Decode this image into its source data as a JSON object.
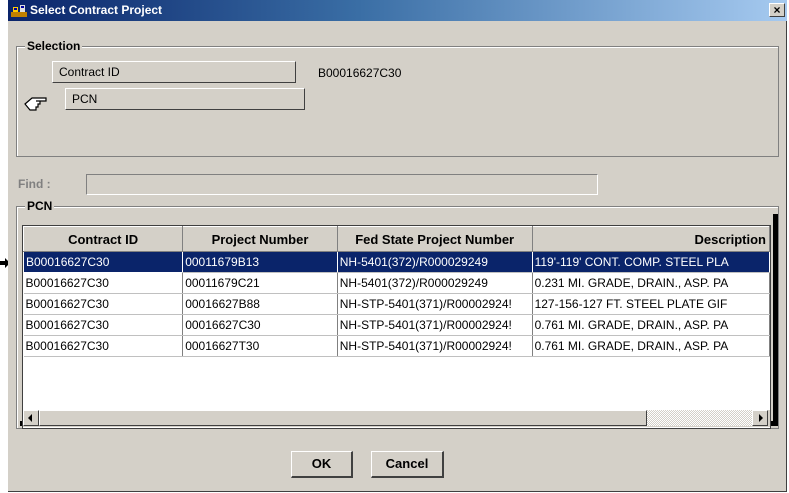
{
  "window": {
    "title": "Select Contract Project",
    "close_label": "×"
  },
  "selection": {
    "group_label": "Selection",
    "contract_id_label": "Contract ID",
    "contract_id_value": "B00016627C30",
    "pcn_label": "PCN",
    "pointer_icon": "pointing-hand-icon"
  },
  "find": {
    "label": "Find :",
    "value": ""
  },
  "pcn": {
    "group_label": "PCN",
    "columns": [
      "Contract ID",
      "Project Number",
      "Fed State Project Number",
      "Description"
    ],
    "rows": [
      [
        "B00016627C30",
        "00011679B13",
        "NH-5401(372)/R000029249",
        "119'-119' CONT. COMP. STEEL PLA"
      ],
      [
        "B00016627C30",
        "00011679C21",
        "NH-5401(372)/R000029249",
        "0.231 MI. GRADE, DRAIN., ASP. PA"
      ],
      [
        "B00016627C30",
        "00016627B88",
        "NH-STP-5401(371)/R00002924!",
        "127-156-127 FT. STEEL PLATE GIF"
      ],
      [
        "B00016627C30",
        "00016627C30",
        "NH-STP-5401(371)/R00002924!",
        "0.761 MI. GRADE, DRAIN., ASP. PA"
      ],
      [
        "B00016627C30",
        "00016627T30",
        "NH-STP-5401(371)/R00002924!",
        "0.761 MI. GRADE, DRAIN., ASP. PA"
      ]
    ],
    "selected_row": 0
  },
  "buttons": {
    "ok": "OK",
    "cancel": "Cancel"
  },
  "colors": {
    "title_bar": "#0a246a",
    "selection": "#0a246a",
    "face": "#d4d0c8"
  }
}
